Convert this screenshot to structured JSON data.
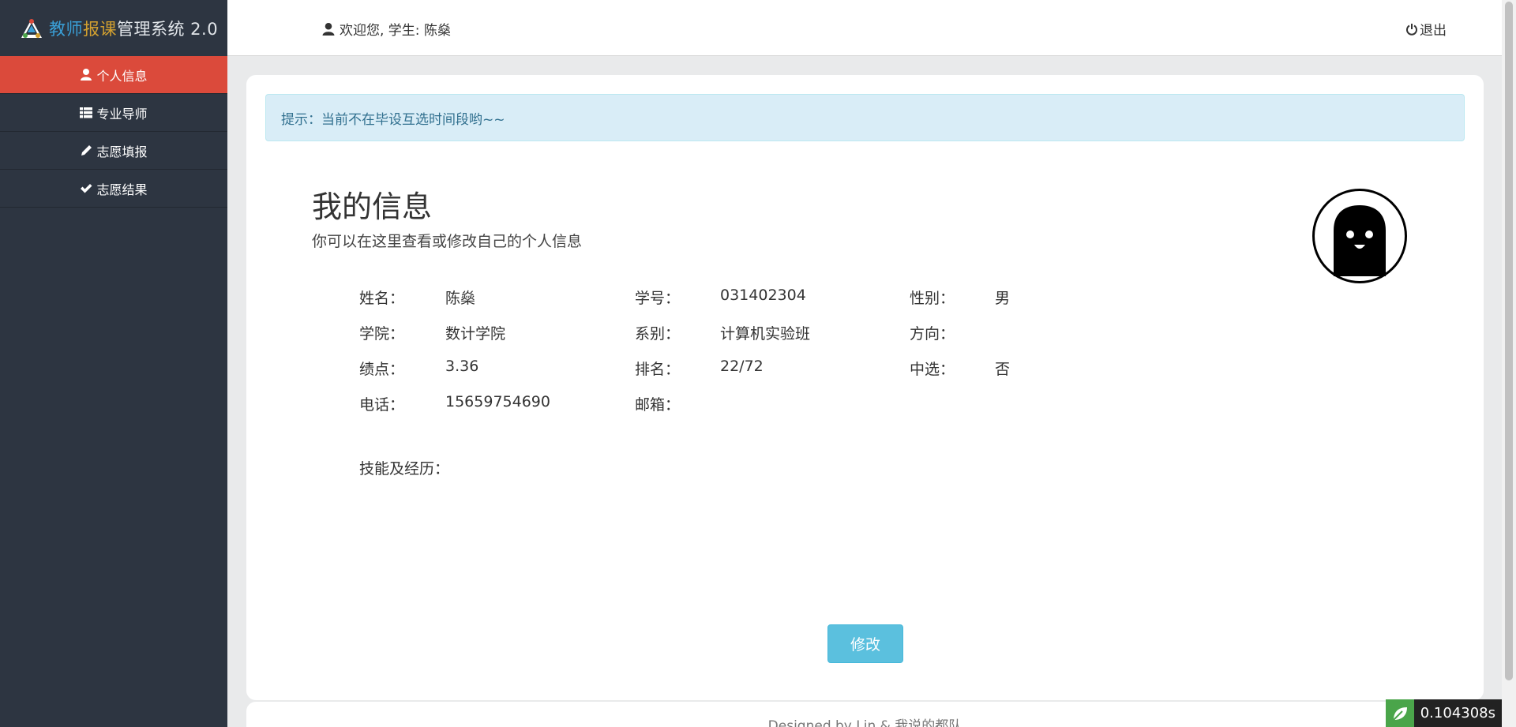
{
  "brand": {
    "part1": "教师",
    "part2": "报课",
    "part3": "管理系统 2.0"
  },
  "sidebar": {
    "items": [
      {
        "label": "个人信息",
        "icon": "user-icon",
        "active": true
      },
      {
        "label": "专业导师",
        "icon": "list-icon",
        "active": false
      },
      {
        "label": "志愿填报",
        "icon": "pencil-icon",
        "active": false
      },
      {
        "label": "志愿结果",
        "icon": "check-icon",
        "active": false
      }
    ]
  },
  "topbar": {
    "welcome": "欢迎您, 学生: 陈燊",
    "logout": "退出"
  },
  "alert": {
    "text": "提示：当前不在毕设互选时间段哟~~"
  },
  "profile": {
    "title": "我的信息",
    "subtitle": "你可以在这里查看或修改自己的个人信息",
    "fields": {
      "name_label": "姓名：",
      "name": "陈燊",
      "id_label": "学号：",
      "id": "031402304",
      "gender_label": "性别：",
      "gender": "男",
      "college_label": "学院：",
      "college": "数计学院",
      "dept_label": "系别：",
      "dept": "计算机实验班",
      "direction_label": "方向：",
      "direction": "",
      "gpa_label": "绩点：",
      "gpa": "3.36",
      "rank_label": "排名：",
      "rank": "22/72",
      "selected_label": "中选：",
      "selected": "否",
      "phone_label": "电话：",
      "phone": "15659754690",
      "email_label": "邮箱：",
      "email": "",
      "skills_label": "技能及经历："
    },
    "edit_button": "修改"
  },
  "footer": {
    "text": "Designed by Lin & 我说的都队"
  },
  "timer": {
    "value": "0.104308s"
  },
  "colors": {
    "sidebar": "#2d3541",
    "active": "#db4a3b",
    "alert_bg": "#d9edf7",
    "button": "#5bc0de"
  }
}
